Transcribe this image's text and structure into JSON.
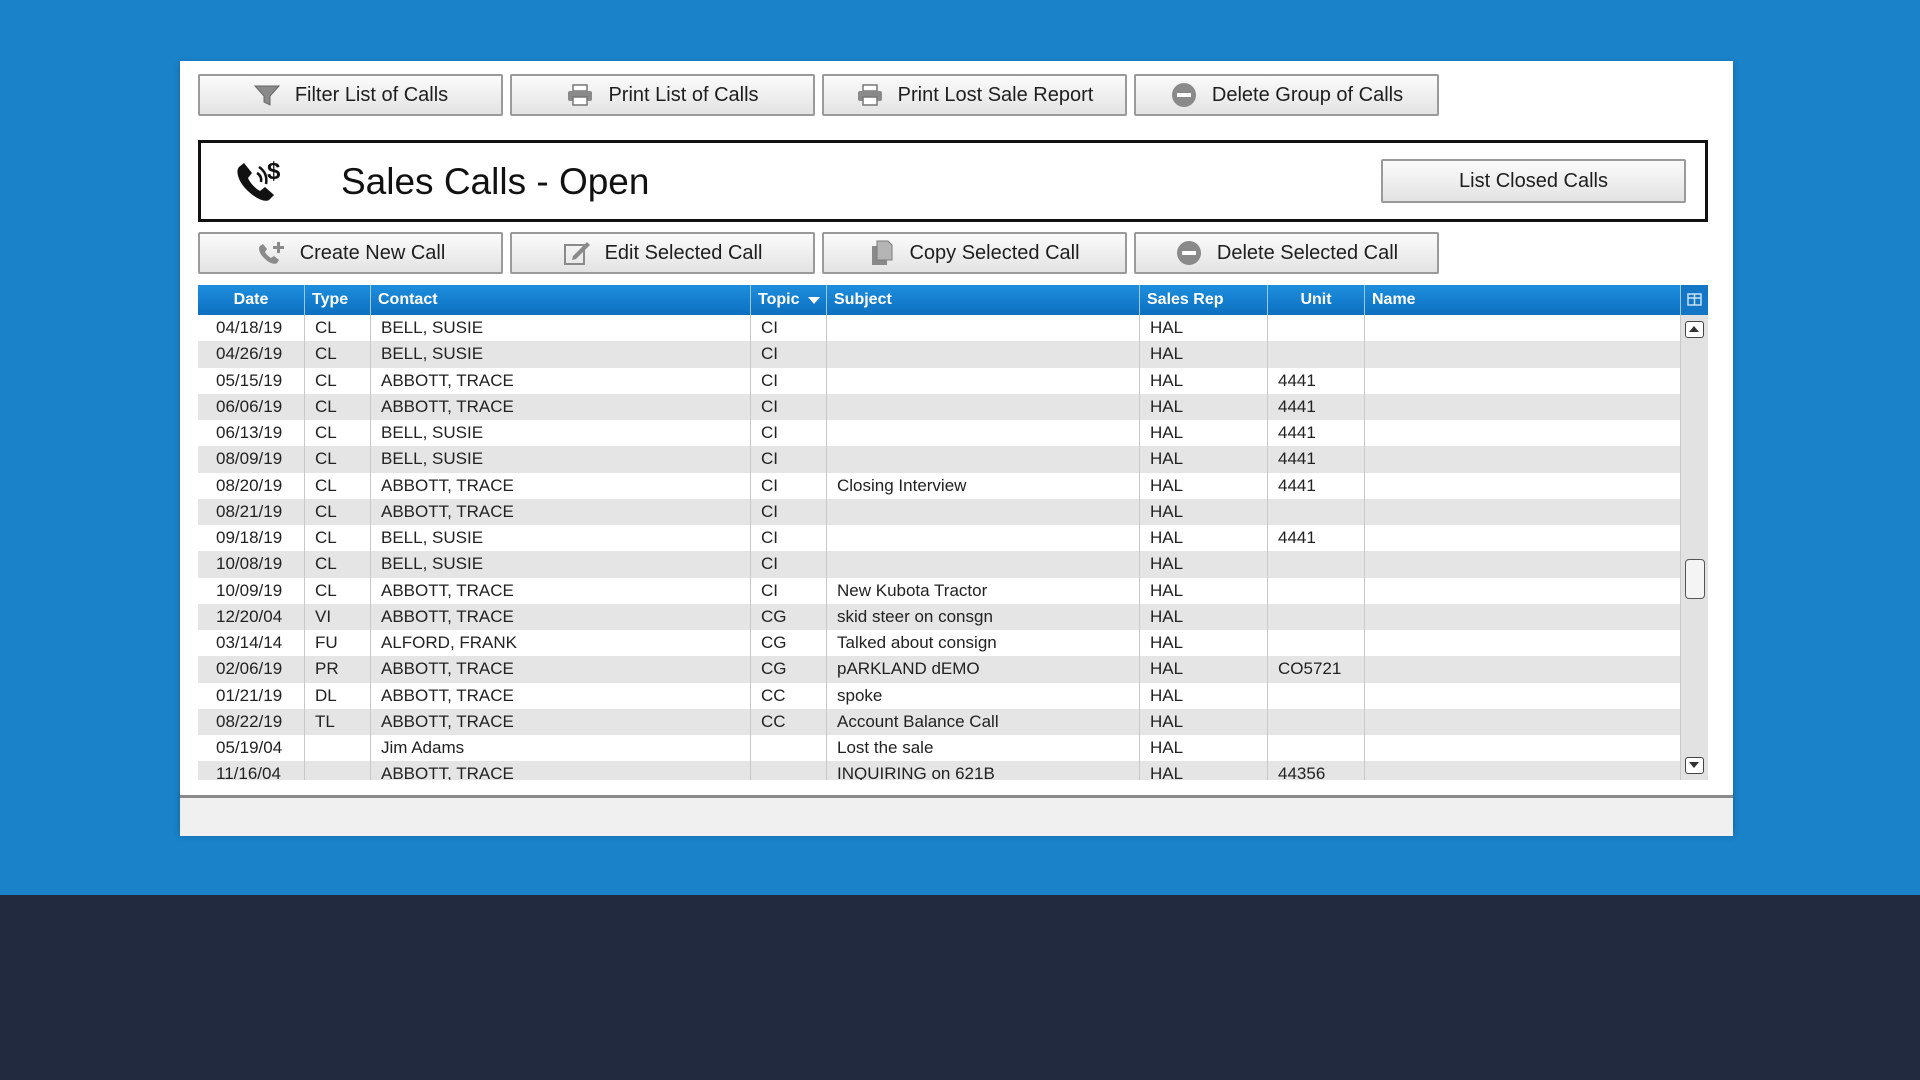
{
  "toolbar": {
    "filter_label": "Filter List of Calls",
    "print_list_label": "Print List of Calls",
    "print_lost_label": "Print Lost Sale Report",
    "delete_group_label": "Delete Group of Calls"
  },
  "header": {
    "title": "Sales Calls - Open",
    "list_closed_label": "List Closed Calls"
  },
  "actions": {
    "create_label": "Create New Call",
    "edit_label": "Edit Selected Call",
    "copy_label": "Copy Selected Call",
    "delete_label": "Delete Selected Call"
  },
  "table": {
    "columns": [
      "Date",
      "Type",
      "Contact",
      "Topic",
      "Subject",
      "Sales Rep",
      "Unit",
      "Name"
    ],
    "sorted_column": "Topic",
    "rows": [
      {
        "date": "04/18/19",
        "type": "CL",
        "contact": "BELL, SUSIE",
        "topic": "CI",
        "subject": "",
        "rep": "HAL",
        "unit": "",
        "name": ""
      },
      {
        "date": "04/26/19",
        "type": "CL",
        "contact": "BELL, SUSIE",
        "topic": "CI",
        "subject": "",
        "rep": "HAL",
        "unit": "",
        "name": ""
      },
      {
        "date": "05/15/19",
        "type": "CL",
        "contact": "ABBOTT, TRACE",
        "topic": "CI",
        "subject": "",
        "rep": "HAL",
        "unit": "4441",
        "name": ""
      },
      {
        "date": "06/06/19",
        "type": "CL",
        "contact": "ABBOTT, TRACE",
        "topic": "CI",
        "subject": "",
        "rep": "HAL",
        "unit": "4441",
        "name": ""
      },
      {
        "date": "06/13/19",
        "type": "CL",
        "contact": "BELL, SUSIE",
        "topic": "CI",
        "subject": "",
        "rep": "HAL",
        "unit": "4441",
        "name": ""
      },
      {
        "date": "08/09/19",
        "type": "CL",
        "contact": "BELL, SUSIE",
        "topic": "CI",
        "subject": "",
        "rep": "HAL",
        "unit": "4441",
        "name": ""
      },
      {
        "date": "08/20/19",
        "type": "CL",
        "contact": "ABBOTT, TRACE",
        "topic": "CI",
        "subject": "Closing Interview",
        "rep": "HAL",
        "unit": "4441",
        "name": ""
      },
      {
        "date": "08/21/19",
        "type": "CL",
        "contact": "ABBOTT, TRACE",
        "topic": "CI",
        "subject": "",
        "rep": "HAL",
        "unit": "",
        "name": ""
      },
      {
        "date": "09/18/19",
        "type": "CL",
        "contact": "BELL, SUSIE",
        "topic": "CI",
        "subject": "",
        "rep": "HAL",
        "unit": "4441",
        "name": ""
      },
      {
        "date": "10/08/19",
        "type": "CL",
        "contact": "BELL, SUSIE",
        "topic": "CI",
        "subject": "",
        "rep": "HAL",
        "unit": "",
        "name": ""
      },
      {
        "date": "10/09/19",
        "type": "CL",
        "contact": "ABBOTT, TRACE",
        "topic": "CI",
        "subject": "New Kubota Tractor",
        "rep": "HAL",
        "unit": "",
        "name": ""
      },
      {
        "date": "12/20/04",
        "type": "VI",
        "contact": "ABBOTT, TRACE",
        "topic": "CG",
        "subject": "skid steer on consgn",
        "rep": "HAL",
        "unit": "",
        "name": ""
      },
      {
        "date": "03/14/14",
        "type": "FU",
        "contact": "ALFORD, FRANK",
        "topic": "CG",
        "subject": "Talked about consign",
        "rep": "HAL",
        "unit": "",
        "name": ""
      },
      {
        "date": "02/06/19",
        "type": "PR",
        "contact": "ABBOTT, TRACE",
        "topic": "CG",
        "subject": "pARKLAND dEMO",
        "rep": "HAL",
        "unit": "CO5721",
        "name": ""
      },
      {
        "date": "01/21/19",
        "type": "DL",
        "contact": "ABBOTT, TRACE",
        "topic": "CC",
        "subject": "spoke",
        "rep": "HAL",
        "unit": "",
        "name": ""
      },
      {
        "date": "08/22/19",
        "type": "TL",
        "contact": "ABBOTT, TRACE",
        "topic": "CC",
        "subject": "Account Balance Call",
        "rep": "HAL",
        "unit": "",
        "name": ""
      },
      {
        "date": "05/19/04",
        "type": "",
        "contact": "Jim Adams",
        "topic": "",
        "subject": "Lost the sale",
        "rep": "HAL",
        "unit": "",
        "name": ""
      },
      {
        "date": "11/16/04",
        "type": "",
        "contact": "ABBOTT, TRACE",
        "topic": "",
        "subject": "INQUIRING on 621B",
        "rep": "HAL",
        "unit": "44356",
        "name": ""
      }
    ]
  },
  "colors": {
    "page_bg": "#1a82c9",
    "footer_bg": "#212a3f",
    "header_blue": "#0d6fbf",
    "row_alt": "#e5e5e5"
  },
  "icons": {
    "filter": "funnel-icon",
    "print": "printer-icon",
    "delete": "minus-circle-icon",
    "phone": "phone-dollar-icon",
    "create": "phone-plus-icon",
    "edit": "edit-icon",
    "copy": "copy-icon",
    "column_chooser": "column-chooser-icon"
  }
}
